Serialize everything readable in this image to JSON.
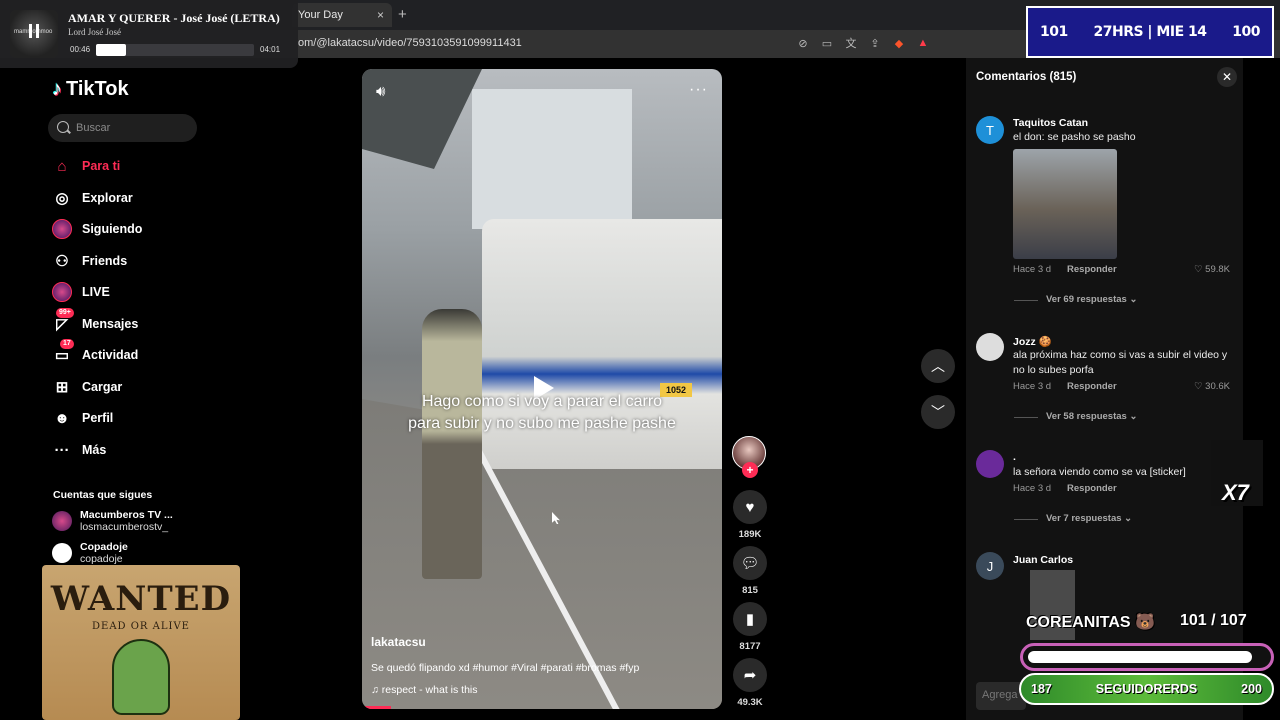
{
  "browser": {
    "tab_title": "Your Day",
    "tab_close": "×",
    "new_tab": "+",
    "url": "om/@lakatacsu/video/7593103591099911431"
  },
  "music": {
    "song": "AMAR Y QUERER - José José (LETRA)",
    "artist": "Lord José José",
    "brand": "mammothmoo",
    "time_current": "00:46",
    "time_total": "04:01",
    "progress": 0.19
  },
  "stream_top": {
    "left": "101",
    "center": "27HRS | MIE 14",
    "right": "100"
  },
  "sidebar": {
    "logo": "TikTok",
    "search_placeholder": "Buscar",
    "nav": [
      {
        "label": "Para ti",
        "icon": "home-icon"
      },
      {
        "label": "Explorar",
        "icon": "compass-icon"
      },
      {
        "label": "Siguiendo",
        "icon": "following-icon"
      },
      {
        "label": "Friends",
        "icon": "friends-icon"
      },
      {
        "label": "LIVE",
        "icon": "live-icon"
      },
      {
        "label": "Mensajes",
        "icon": "messages-icon",
        "badge": "99+"
      },
      {
        "label": "Actividad",
        "icon": "activity-icon",
        "badge": "17"
      },
      {
        "label": "Cargar",
        "icon": "upload-icon"
      },
      {
        "label": "Perfil",
        "icon": "profile-icon"
      },
      {
        "label": "Más",
        "icon": "more-icon"
      }
    ],
    "following_title": "Cuentas que sigues",
    "following": [
      {
        "name": "Macumberos TV ...",
        "user": "losmacumberostv_"
      },
      {
        "name": "Copadoje",
        "user": "copadoje"
      }
    ]
  },
  "poster": {
    "title": "WANTED",
    "subtitle": "DEAD OR ALIVE"
  },
  "video": {
    "caption_line1": "Hago como si voy a parar el carro",
    "caption_line2": "para subir y no subo me pashe pashe",
    "bus_plate": "1052",
    "author": "lakatacsu",
    "description": "Se quedó flipando xd #humor #Viral #parati #bromas #fyp",
    "sound": "♫  respect - what is this",
    "progress": 0.08
  },
  "actions": {
    "likes": "189K",
    "comments": "815",
    "saves": "8177",
    "shares": "49.3K"
  },
  "comments": {
    "title": "Comentarios (815)",
    "items": [
      {
        "initial": "T",
        "name": "Taquitos Catan",
        "text": "el don: se pasho se pasho",
        "time": "Hace 3 d",
        "reply": "Responder",
        "likes": "59.8K",
        "replies": "Ver 69 respuestas ⌄"
      },
      {
        "initial": "",
        "name": "Jozz 🍪",
        "text": "ala próxima haz como si vas a subir el video y no lo subes porfa",
        "time": "Hace 3 d",
        "reply": "Responder",
        "likes": "30.6K",
        "replies": "Ver 58 respuestas ⌄"
      },
      {
        "initial": "",
        "name": ".",
        "text": "la señora viendo como se va [sticker]",
        "time": "Hace 3 d",
        "reply": "Responder",
        "likes": "",
        "replies": "Ver 7 respuestas ⌄"
      },
      {
        "initial": "J",
        "name": "Juan Carlos",
        "text": "",
        "time": "",
        "reply": "",
        "likes": "",
        "replies": ""
      }
    ],
    "input_placeholder": "Agrega"
  },
  "stream_bottom": {
    "multiplier": "X7",
    "goal1_label": "COREANITAS 🐻",
    "goal1_count": "101  / 107",
    "goal1_progress": 0.94,
    "goal2_left": "187",
    "goal2_label": "SEGUIDORERDS",
    "goal2_right": "200"
  },
  "colors": {
    "accent": "#fe2c55",
    "stream_blue": "#1a1a8a",
    "goal_green": "#5dbb3a",
    "goal_pink": "#c861b8"
  }
}
